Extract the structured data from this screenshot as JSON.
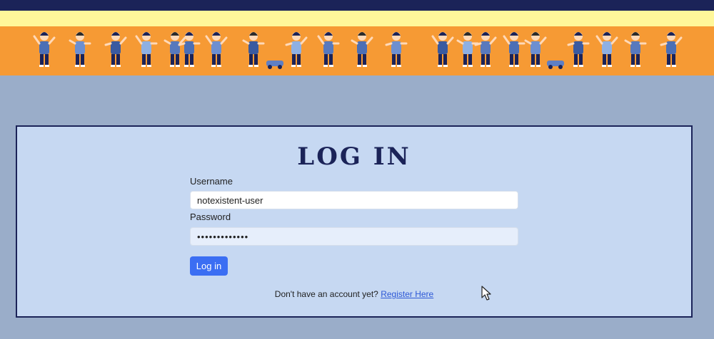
{
  "header": {
    "colors": {
      "topbar": "#1b2358",
      "stripe": "#fff79a",
      "banner": "#f69a34",
      "page_bg": "#9aadc9"
    },
    "banner_icon": "children-playing-illustration"
  },
  "login": {
    "title": "LOG IN",
    "username_label": "Username",
    "username_value": "notexistent-user",
    "password_label": "Password",
    "password_value": "•••••••••••••",
    "submit_label": "Log in",
    "register_prompt": "Don't have an account yet?",
    "register_link": "Register Here",
    "colors": {
      "card_bg": "#c6d8f2",
      "button": "#3b6ef3",
      "link": "#2d58d6"
    }
  }
}
